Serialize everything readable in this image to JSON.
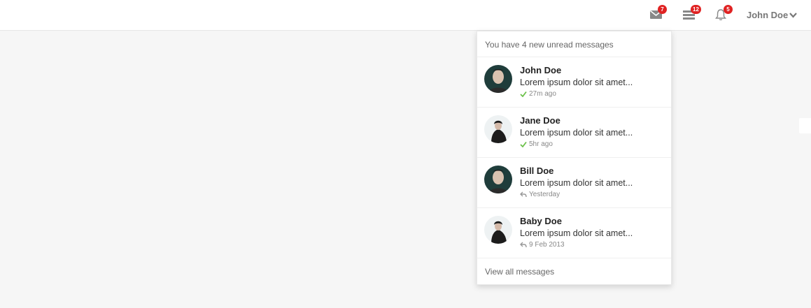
{
  "topbar": {
    "icons": [
      {
        "name": "envelope-icon",
        "badge": "7"
      },
      {
        "name": "tasks-icon",
        "badge": "12"
      },
      {
        "name": "bell-icon",
        "badge": "5"
      }
    ],
    "user_name": "John Doe",
    "badge_color": "#e02222"
  },
  "messages_dropdown": {
    "header": "You have 4 new unread messages",
    "items": [
      {
        "name": "John Doe",
        "text": "Lorem ipsum dolor sit amet...",
        "time": "27m ago",
        "status": "check-icon",
        "avatar": "male"
      },
      {
        "name": "Jane Doe",
        "text": "Lorem ipsum dolor sit amet...",
        "time": "5hr ago",
        "status": "check-icon",
        "avatar": "female"
      },
      {
        "name": "Bill Doe",
        "text": "Lorem ipsum dolor sit amet...",
        "time": "Yesterday",
        "status": "reply-icon",
        "avatar": "male"
      },
      {
        "name": "Baby Doe",
        "text": "Lorem ipsum dolor sit amet...",
        "time": "9 Feb 2013",
        "status": "reply-icon",
        "avatar": "female"
      }
    ],
    "footer": "View all messages",
    "check_color": "#6cc04a"
  }
}
